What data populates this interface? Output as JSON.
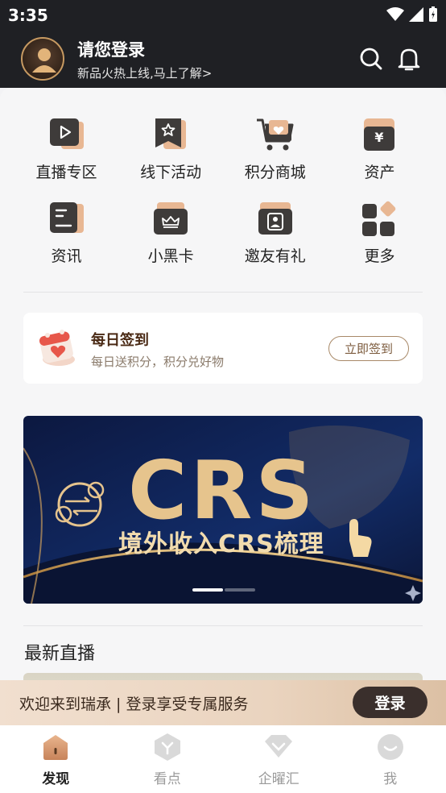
{
  "status_bar": {
    "time": "3:35"
  },
  "header": {
    "title": "请您登录",
    "subtitle": "新品火热上线,马上了解>",
    "search_icon": "search-icon",
    "bell_icon": "bell-icon"
  },
  "grid": {
    "items": [
      {
        "label": "直播专区",
        "icon": "live-video-icon"
      },
      {
        "label": "线下活动",
        "icon": "star-flag-icon"
      },
      {
        "label": "积分商城",
        "icon": "shopping-cart-icon"
      },
      {
        "label": "资产",
        "icon": "yen-wallet-icon"
      },
      {
        "label": "资讯",
        "icon": "news-document-icon"
      },
      {
        "label": "小黑卡",
        "icon": "crown-card-icon"
      },
      {
        "label": "邀友有礼",
        "icon": "gift-friend-icon"
      },
      {
        "label": "更多",
        "icon": "more-grid-icon"
      }
    ]
  },
  "signin": {
    "title": "每日签到",
    "subtitle": "每日送积分，积分兑好物",
    "button": "立即签到",
    "icon": "calendar-heart-icon"
  },
  "banner": {
    "headline": "CRS",
    "subheadline": "境外收入CRS梳理",
    "slide_count": 2,
    "active_slide": 1
  },
  "live_section": {
    "title": "最新直播"
  },
  "login_prompt": {
    "text": "欢迎来到瑞承 | 登录享受专属服务",
    "button": "登录"
  },
  "tabbar": {
    "tabs": [
      {
        "label": "发现",
        "icon": "discover-icon",
        "active": true
      },
      {
        "label": "看点",
        "icon": "highlights-icon",
        "active": false
      },
      {
        "label": "企曜汇",
        "icon": "diamond-icon",
        "active": false
      },
      {
        "label": "我",
        "icon": "profile-icon",
        "active": false
      }
    ]
  },
  "colors": {
    "header_bg": "#1f2024",
    "accent_gold": "#c79a62",
    "prompt_button": "#3a2f2c",
    "banner_bg": "#0f1d4a"
  }
}
